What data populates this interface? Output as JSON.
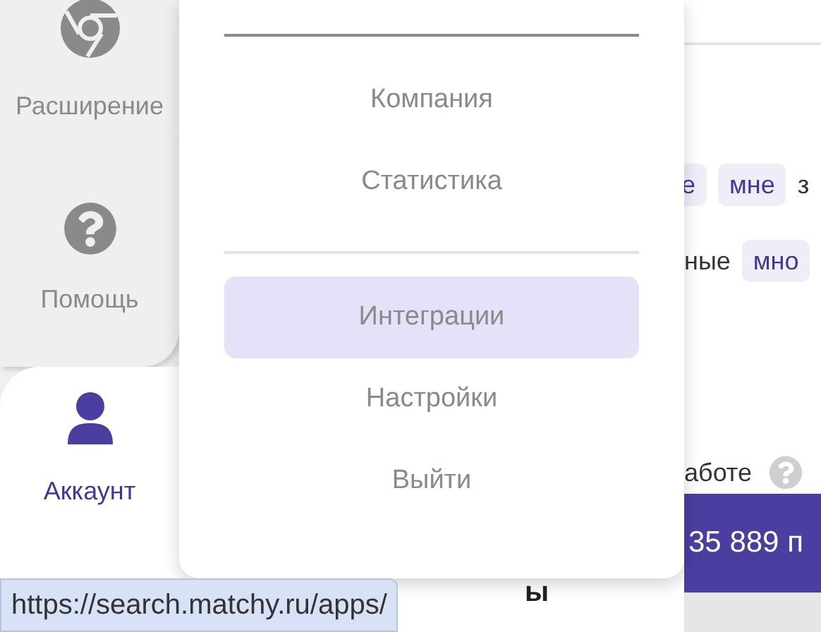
{
  "sidebar": {
    "items": [
      {
        "label": "Расширение",
        "kind": "extension",
        "selected": false
      },
      {
        "label": "Помощь",
        "kind": "help",
        "selected": false
      },
      {
        "label": "Аккаунт",
        "kind": "account",
        "selected": true
      }
    ]
  },
  "menu": {
    "sections": [
      {
        "items": [
          {
            "label": "Компания",
            "selected": false
          },
          {
            "label": "Статистика",
            "selected": false
          }
        ]
      },
      {
        "items": [
          {
            "label": "Интеграции",
            "selected": true
          },
          {
            "label": "Настройки",
            "selected": false
          },
          {
            "label": "Выйти",
            "selected": false
          }
        ]
      }
    ]
  },
  "content": {
    "row_1": [
      {
        "text": "е",
        "kind": "tag"
      },
      {
        "text": "мне",
        "kind": "tag"
      },
      {
        "text": "з",
        "kind": "text"
      }
    ],
    "row_2": [
      {
        "text": "ные",
        "kind": "text"
      },
      {
        "text": "мно",
        "kind": "tag"
      }
    ],
    "hint": "аботе",
    "counter": "35 889 п",
    "heading": "ы"
  },
  "status_url": "https://search.matchy.ru/apps/"
}
